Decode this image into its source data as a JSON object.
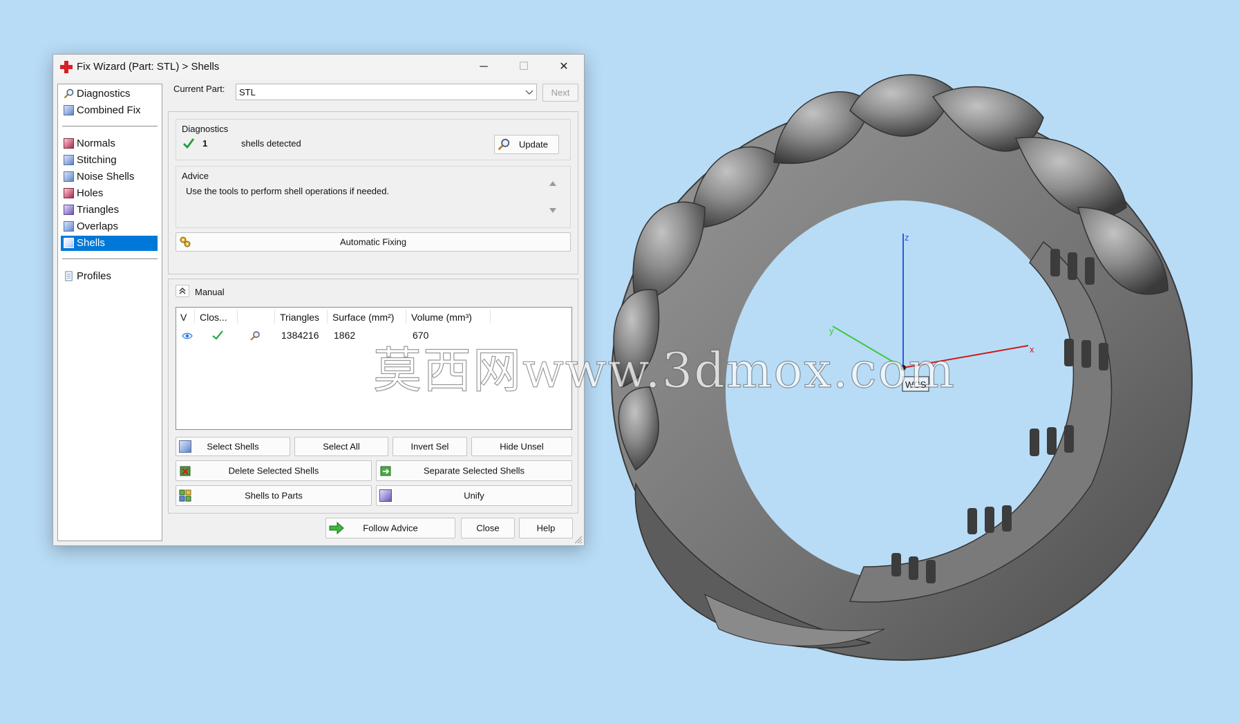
{
  "window": {
    "title": "Fix Wizard (Part: STL) > Shells",
    "minimize": "─",
    "maximize": "☐",
    "close": "✕"
  },
  "sidebar": {
    "items": [
      {
        "label": "Diagnostics",
        "icon": "magnifier-icon"
      },
      {
        "label": "Combined Fix",
        "icon": "cube-icon"
      },
      {
        "label": "Normals",
        "icon": "normals-icon"
      },
      {
        "label": "Stitching",
        "icon": "stitching-icon"
      },
      {
        "label": "Noise Shells",
        "icon": "noise-shells-icon"
      },
      {
        "label": "Holes",
        "icon": "holes-icon"
      },
      {
        "label": "Triangles",
        "icon": "triangles-icon"
      },
      {
        "label": "Overlaps",
        "icon": "overlaps-icon"
      },
      {
        "label": "Shells",
        "icon": "shells-icon",
        "selected": true
      },
      {
        "label": "Profiles",
        "icon": "document-icon"
      }
    ]
  },
  "current_part": {
    "label": "Current Part:",
    "value": "STL",
    "next_button": "Next"
  },
  "diagnostics": {
    "heading": "Diagnostics",
    "count": "1",
    "text": "shells detected",
    "update_button": "Update"
  },
  "advice": {
    "heading": "Advice",
    "text": "Use the tools to perform shell operations if needed.",
    "automatic_fixing_button": "Automatic Fixing"
  },
  "manual": {
    "heading": "Manual",
    "columns": [
      "V",
      "Clos...",
      "",
      "Triangles",
      "Surface (mm²)",
      "Volume (mm³)"
    ],
    "rows": [
      {
        "triangles": "1384216",
        "surface": "1862",
        "volume": "670"
      }
    ],
    "buttons": {
      "select_shells": "Select Shells",
      "select_all": "Select All",
      "invert_sel": "Invert Sel",
      "hide_unsel": "Hide Unsel",
      "delete_selected": "Delete Selected Shells",
      "separate_selected": "Separate Selected Shells",
      "shells_to_parts": "Shells to Parts",
      "unify": "Unify"
    }
  },
  "footer": {
    "follow_advice": "Follow Advice",
    "close": "Close",
    "help": "Help"
  },
  "viewport": {
    "axis_x": "x",
    "axis_y": "y",
    "axis_z": "z",
    "wcs": "WCS",
    "watermark": "莫西网www.3dmox.com",
    "colors": {
      "x": "#cc1a1a",
      "y": "#3cc83c",
      "z": "#2a5ad8",
      "background": "#b8dcf6"
    }
  }
}
